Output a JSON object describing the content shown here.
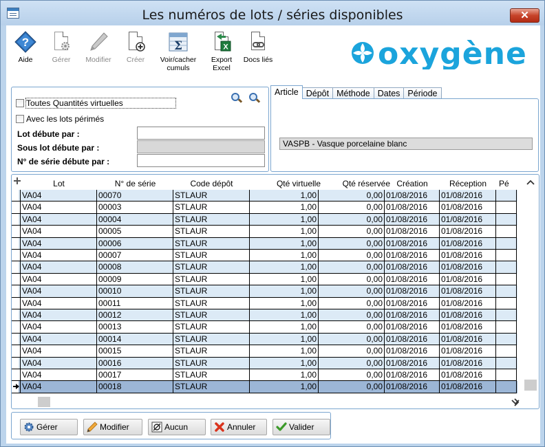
{
  "window": {
    "title": "Les numéros de lots / séries disponibles",
    "close_glyph": "✕"
  },
  "toolbar": {
    "aide": "Aide",
    "gerer": "Gérer",
    "modifier": "Modifier",
    "creer": "Créer",
    "voir_cacher": "Voir/cacher cumuls",
    "export_excel": "Export Excel",
    "docs_lies": "Docs liés"
  },
  "logo": {
    "text": "oxygène"
  },
  "filters": {
    "toutes_quantites": "Toutes Quantités virtuelles",
    "lots_perimes": "Avec les lots périmés",
    "lot_debute": "Lot débute par :",
    "sous_lot_debute": "Sous lot débute par :",
    "serie_debute": "N° de série débute par :",
    "lot_value": "",
    "sous_lot_value": "",
    "serie_value": ""
  },
  "tabs": [
    "Article",
    "Dépôt",
    "Méthode",
    "Dates",
    "Période"
  ],
  "article": {
    "value": "VASPB - Vasque porcelaine blanc"
  },
  "grid": {
    "columns": [
      "Lot",
      "N° de série",
      "Code dépôt",
      "Qté virtuelle",
      "Qté  réservée",
      "Création",
      "Réception",
      "Pé"
    ],
    "rows": [
      [
        "VA04",
        "00070",
        "STLAUR",
        "1,00",
        "0,00",
        "01/08/2016",
        "01/08/2016"
      ],
      [
        "VA04",
        "00003",
        "STLAUR",
        "1,00",
        "0,00",
        "01/08/2016",
        "01/08/2016"
      ],
      [
        "VA04",
        "00004",
        "STLAUR",
        "1,00",
        "0,00",
        "01/08/2016",
        "01/08/2016"
      ],
      [
        "VA04",
        "00005",
        "STLAUR",
        "1,00",
        "0,00",
        "01/08/2016",
        "01/08/2016"
      ],
      [
        "VA04",
        "00006",
        "STLAUR",
        "1,00",
        "0,00",
        "01/08/2016",
        "01/08/2016"
      ],
      [
        "VA04",
        "00007",
        "STLAUR",
        "1,00",
        "0,00",
        "01/08/2016",
        "01/08/2016"
      ],
      [
        "VA04",
        "00008",
        "STLAUR",
        "1,00",
        "0,00",
        "01/08/2016",
        "01/08/2016"
      ],
      [
        "VA04",
        "00009",
        "STLAUR",
        "1,00",
        "0,00",
        "01/08/2016",
        "01/08/2016"
      ],
      [
        "VA04",
        "00010",
        "STLAUR",
        "1,00",
        "0,00",
        "01/08/2016",
        "01/08/2016"
      ],
      [
        "VA04",
        "00011",
        "STLAUR",
        "1,00",
        "0,00",
        "01/08/2016",
        "01/08/2016"
      ],
      [
        "VA04",
        "00012",
        "STLAUR",
        "1,00",
        "0,00",
        "01/08/2016",
        "01/08/2016"
      ],
      [
        "VA04",
        "00013",
        "STLAUR",
        "1,00",
        "0,00",
        "01/08/2016",
        "01/08/2016"
      ],
      [
        "VA04",
        "00014",
        "STLAUR",
        "1,00",
        "0,00",
        "01/08/2016",
        "01/08/2016"
      ],
      [
        "VA04",
        "00015",
        "STLAUR",
        "1,00",
        "0,00",
        "01/08/2016",
        "01/08/2016"
      ],
      [
        "VA04",
        "00016",
        "STLAUR",
        "1,00",
        "0,00",
        "01/08/2016",
        "01/08/2016"
      ],
      [
        "VA04",
        "00017",
        "STLAUR",
        "1,00",
        "0,00",
        "01/08/2016",
        "01/08/2016"
      ],
      [
        "VA04",
        "00018",
        "STLAUR",
        "1,00",
        "0,00",
        "01/08/2016",
        "01/08/2016"
      ]
    ],
    "selected_row": 16
  },
  "buttons": {
    "gerer": "Gérer",
    "modifier": "Modifier",
    "aucun": "Aucun",
    "annuler": "Annuler",
    "valider": "Valider"
  },
  "colors": {
    "accent": "#1ba4dc",
    "row_alt": "#dceaf6",
    "row_selected": "#9cb6d6",
    "panel_border": "#7aa5cf"
  }
}
